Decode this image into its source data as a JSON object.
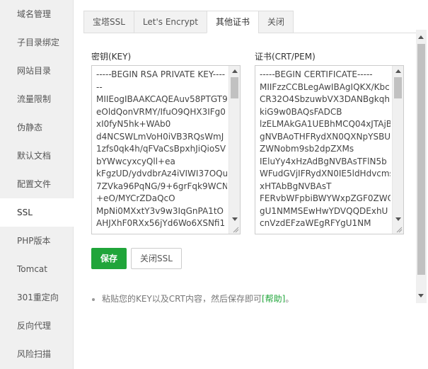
{
  "sidebar": {
    "items": [
      {
        "label": "域名管理"
      },
      {
        "label": "子目录绑定"
      },
      {
        "label": "网站目录"
      },
      {
        "label": "流量限制"
      },
      {
        "label": "伪静态"
      },
      {
        "label": "默认文档"
      },
      {
        "label": "配置文件"
      },
      {
        "label": "SSL",
        "active": true
      },
      {
        "label": "PHP版本"
      },
      {
        "label": "Tomcat"
      },
      {
        "label": "301重定向"
      },
      {
        "label": "反向代理"
      },
      {
        "label": "风险扫描"
      }
    ]
  },
  "tabs": [
    {
      "label": "宝塔SSL"
    },
    {
      "label": "Let's Encrypt"
    },
    {
      "label": "其他证书",
      "active": true
    },
    {
      "label": "关闭"
    }
  ],
  "key_field": {
    "label": "密钥(KEY)",
    "lines": "-----BEGIN RSA PRIVATE KEY----\n--\nMIIEogIBAAKCAQEAuv58PTGT9\neOldQonVRMY/IfuO9QHX3IFg0\nxI0fyN5hk+WAb0\nd4NCSWLmVoH0iVB3RQsWmJ\n1zfs0qk4h/qFVaCsBpxhJiQioSV\nbYWwcyxcyQll+ea\nkFgzUD/ydvdbrAz4iVIWI37OQu\n7ZVka96PqNG/9+6grFqk9WCN\n+eO/MYCrZDaQcO\nMpNi0MXxtY3v9w3IqGnPA1tO\nAHJXhF0RXx56jYd6Wo6XSNfi1"
  },
  "cert_field": {
    "label": "证书(CRT/PEM)",
    "lines": "-----BEGIN CERTIFICATE-----\nMIIFzzCCBLegAwIBAgIQKX/Kbc\nCR32O4SbzuwbVX3DANBgkqh\nkiG9w0BAQsFADCB\nlzELMAkGA1UEBhMCQ04xJTAjB\ngNVBAoTHFRydXN0QXNpYSBU\nZWNobm9sb2dpZXMs\nIEluYy4xHzAdBgNVBAsTFlN5b\nWFudGVjIFRydXN0IE5ldHdvcms\nxHTAbBgNVBAsT\nFERvbWFpbiBWYWxpZGF0ZWQ\ngU1NMMSEwHwYDVQQDExhU\ncnVzdEFzaWEgRFYgU1NM"
  },
  "buttons": {
    "save": "保存",
    "close_ssl": "关闭SSL"
  },
  "tip": {
    "text": "粘贴您的KEY以及CRT内容，然后保存即可",
    "link": "[帮助]",
    "end": "。"
  }
}
